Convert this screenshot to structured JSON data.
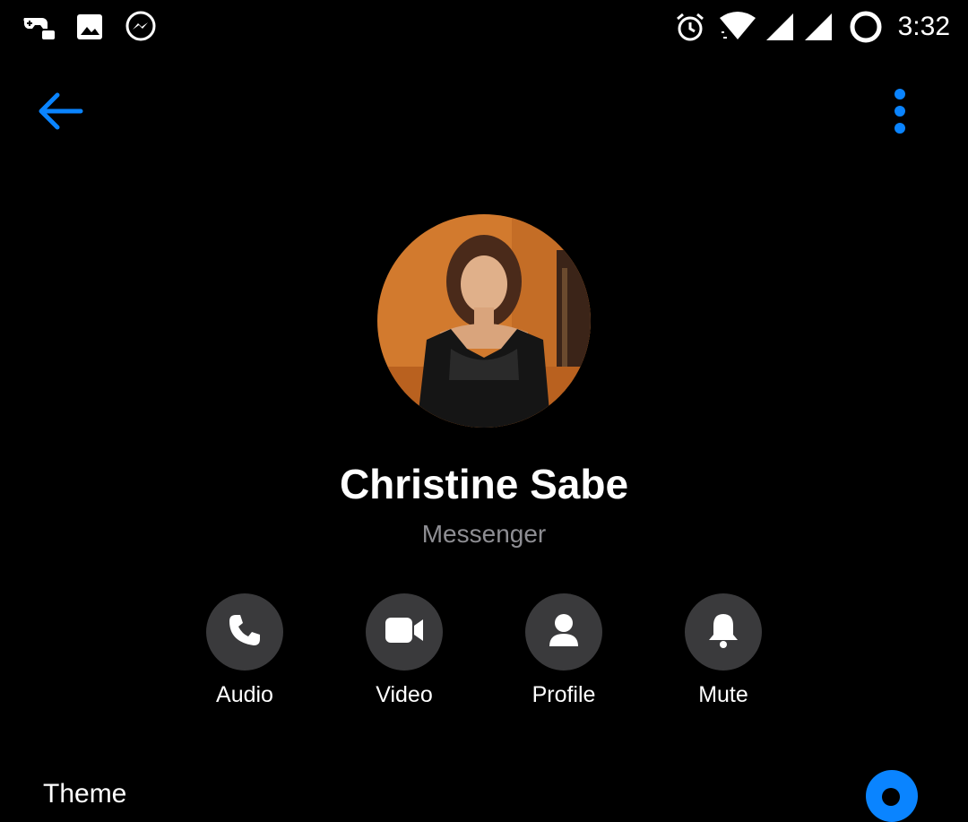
{
  "status_bar": {
    "time": "3:32",
    "left_icons": [
      "game-controller-icon",
      "gallery-icon",
      "messenger-icon"
    ],
    "right_icons": [
      "alarm-icon",
      "wifi-icon",
      "signal-icon",
      "signal-icon",
      "battery-ring-icon"
    ]
  },
  "header": {
    "back_icon": "arrow-left-icon",
    "more_icon": "more-vertical-icon"
  },
  "contact": {
    "name": "Christine Sabe",
    "subtitle": "Messenger"
  },
  "actions": [
    {
      "label": "Audio",
      "icon": "phone-icon"
    },
    {
      "label": "Video",
      "icon": "video-camera-icon"
    },
    {
      "label": "Profile",
      "icon": "person-icon"
    },
    {
      "label": "Mute",
      "icon": "bell-icon"
    }
  ],
  "settings": {
    "theme_label": "Theme"
  },
  "colors": {
    "background": "#000000",
    "accent": "#0a84ff",
    "button_bg": "#3a3a3c",
    "secondary_text": "#8e8e93"
  }
}
